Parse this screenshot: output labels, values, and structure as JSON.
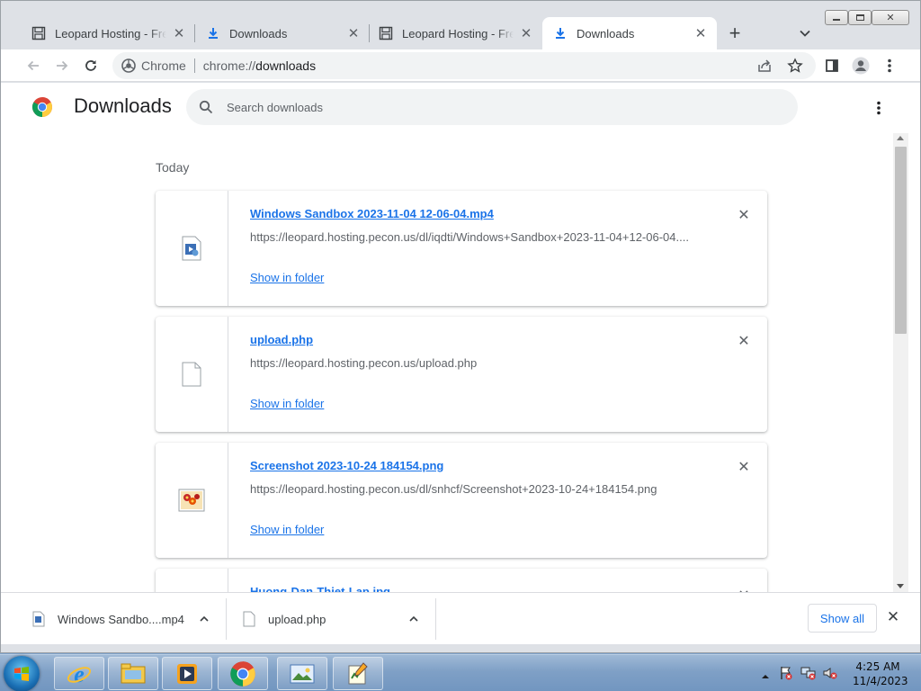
{
  "tabs": [
    {
      "title": "Leopard Hosting - Free",
      "icon": "page-icon",
      "active": false
    },
    {
      "title": "Downloads",
      "icon": "download-icon",
      "active": false
    },
    {
      "title": "Leopard Hosting - Free",
      "icon": "page-icon",
      "active": false
    },
    {
      "title": "Downloads",
      "icon": "download-icon",
      "active": true
    }
  ],
  "omnibox": {
    "chip_label": "Chrome",
    "url_scheme": "chrome://",
    "url_path": "downloads"
  },
  "page": {
    "title": "Downloads",
    "search_placeholder": "Search downloads",
    "day_label": "Today"
  },
  "downloads": [
    {
      "file_name": "Windows Sandbox 2023-11-04 12-06-04.mp4",
      "url": "https://leopard.hosting.pecon.us/dl/iqdti/Windows+Sandbox+2023-11-04+12-06-04....",
      "action": "Show in folder",
      "icon": "video-file-icon"
    },
    {
      "file_name": "upload.php",
      "url": "https://leopard.hosting.pecon.us/upload.php",
      "action": "Show in folder",
      "icon": "blank-file-icon"
    },
    {
      "file_name": "Screenshot 2023-10-24 184154.png",
      "url": "https://leopard.hosting.pecon.us/dl/snhcf/Screenshot+2023-10-24+184154.png",
      "action": "Show in folder",
      "icon": "image-file-icon"
    },
    {
      "file_name": "Huong-Dan-Thiet-Lap.jpg",
      "url": "",
      "action": "",
      "icon": "image-file-icon"
    }
  ],
  "shelf": {
    "items": [
      {
        "label": "Windows Sandbo....mp4",
        "icon": "video-file-icon"
      },
      {
        "label": "upload.php",
        "icon": "blank-file-icon"
      }
    ],
    "show_all_label": "Show all"
  },
  "taskbar": {
    "apps": [
      "internet-explorer-icon",
      "file-explorer-icon",
      "media-player-icon",
      "chrome-icon",
      "image-viewer-icon",
      "editor-icon"
    ],
    "time": "4:25 AM",
    "date": "11/4/2023"
  },
  "colors": {
    "accent": "#1a73e8",
    "tab_strip": "#dee1e6",
    "text": "#202124",
    "muted": "#5f6368"
  }
}
